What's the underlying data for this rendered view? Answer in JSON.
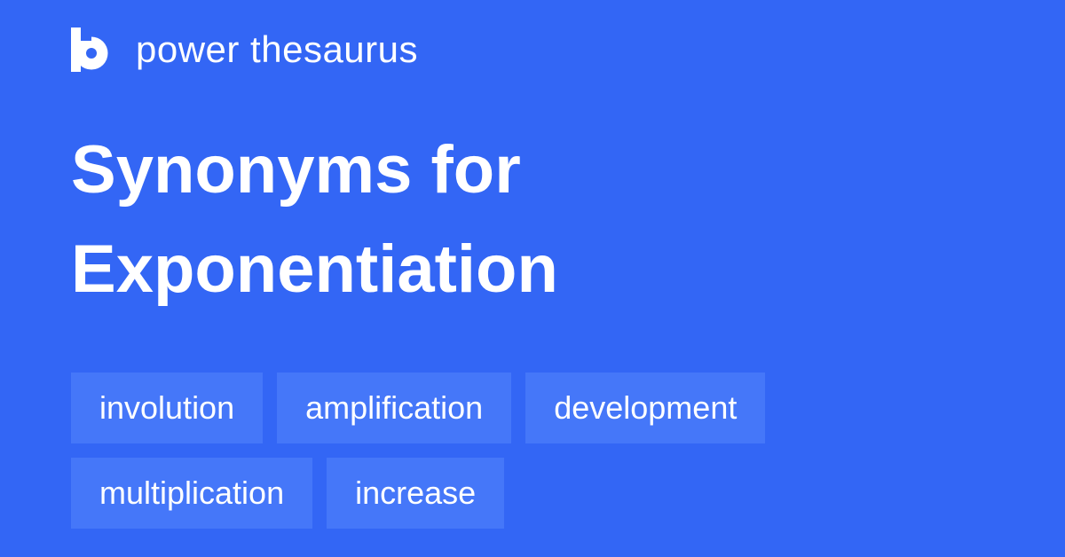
{
  "brand": {
    "name": "power thesaurus",
    "logo_icon": "power-thesaurus-logo"
  },
  "headline": {
    "line1": "Synonyms for",
    "line2": "Exponentiation"
  },
  "synonyms": [
    "involution",
    "amplification",
    "development",
    "multiplication",
    "increase"
  ],
  "colors": {
    "background": "#3366F5",
    "chip": "#4577F9",
    "text": "#FFFFFF"
  }
}
